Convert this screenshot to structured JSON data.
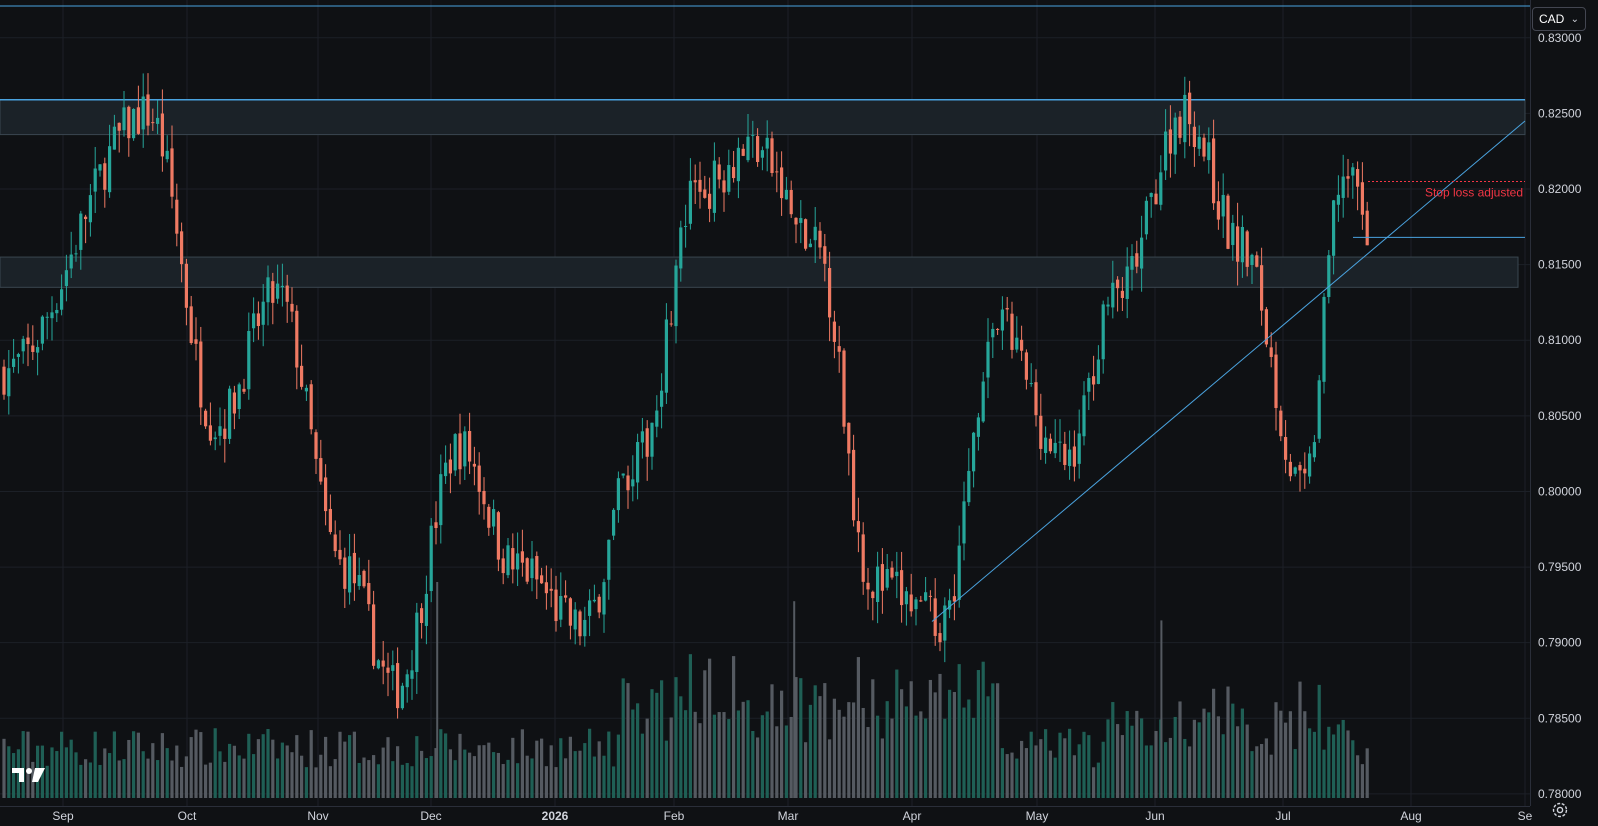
{
  "currency_selector": {
    "label": "CAD"
  },
  "annotations": {
    "stop_loss_text": "Stop loss adjusted"
  },
  "colors": {
    "up": "#26a69a",
    "down": "#ef7a63",
    "trendline": "#4aa3df",
    "zone_line": "#4aa3df",
    "stop_line": "#f23645",
    "volume_up": "#1f5f55",
    "volume_down": "#555a61"
  },
  "icons": {
    "logo": "tradingview-logo",
    "settings": "gear-icon"
  },
  "chart_data": {
    "type": "candlestick",
    "y_axis": {
      "ticks": [
        "0.83000",
        "0.82500",
        "0.82000",
        "0.81500",
        "0.81000",
        "0.80500",
        "0.80000",
        "0.79500",
        "0.79000",
        "0.78500",
        "0.78000"
      ],
      "range": [
        0.7792,
        0.8325
      ]
    },
    "x_axis": {
      "ticks": [
        "Sep",
        "Oct",
        "Nov",
        "Dec",
        "2026",
        "Feb",
        "Mar",
        "Apr",
        "May",
        "Jun",
        "Jul",
        "Aug",
        "Se"
      ]
    },
    "grid": true,
    "resistance_zone": [
      0.8236,
      0.8259
    ],
    "support_zone": [
      0.8135,
      0.8155
    ],
    "trendline": {
      "from": {
        "x": "Apr",
        "y": 0.7914
      },
      "to": {
        "x": "Aug",
        "y": 0.8245
      }
    },
    "stop_loss_level": 0.8205,
    "level_line": 0.8168,
    "price_path": [
      {
        "x": "Sep",
        "y": 0.808
      },
      {
        "x": "Sep",
        "y": 0.825
      },
      {
        "x": "Oct",
        "y": 0.8045
      },
      {
        "x": "Oct",
        "y": 0.813
      },
      {
        "x": "Nov",
        "y": 0.795
      },
      {
        "x": "Nov",
        "y": 0.787
      },
      {
        "x": "Dec",
        "y": 0.803
      },
      {
        "x": "Dec",
        "y": 0.795
      },
      {
        "x": "2026",
        "y": 0.791
      },
      {
        "x": "2026",
        "y": 0.802
      },
      {
        "x": "Feb",
        "y": 0.82
      },
      {
        "x": "Feb",
        "y": 0.823
      },
      {
        "x": "Mar",
        "y": 0.816
      },
      {
        "x": "Mar",
        "y": 0.794
      },
      {
        "x": "Apr",
        "y": 0.7915
      },
      {
        "x": "Apr",
        "y": 0.811
      },
      {
        "x": "May",
        "y": 0.802
      },
      {
        "x": "May",
        "y": 0.813
      },
      {
        "x": "Jun",
        "y": 0.825
      },
      {
        "x": "Jun",
        "y": 0.816
      },
      {
        "x": "Jul",
        "y": 0.8
      },
      {
        "x": "Jul",
        "y": 0.821
      },
      {
        "x": "Jul",
        "y": 0.817
      }
    ],
    "volume_peaks": [
      {
        "x": "Dec",
        "v": 0.45
      },
      {
        "x": "Mar",
        "v": 0.41
      },
      {
        "x": "Jun",
        "v": 0.37
      }
    ]
  }
}
